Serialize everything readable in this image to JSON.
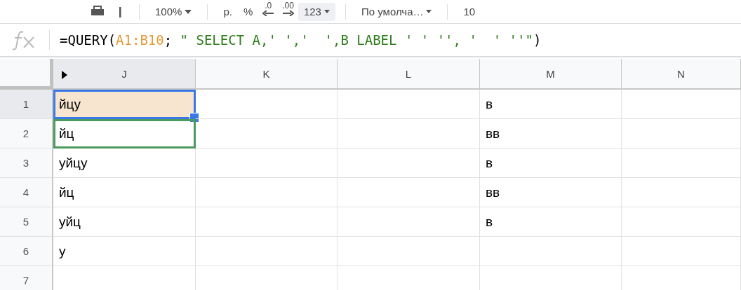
{
  "toolbar": {
    "zoom": "100%",
    "items": [
      {
        "kind": "text",
        "label": "р."
      },
      {
        "kind": "text",
        "label": "%"
      },
      {
        "kind": "decrease",
        "label": ".0"
      },
      {
        "kind": "increase",
        "label": ".00"
      },
      {
        "kind": "menu",
        "label": "123",
        "selected": true
      },
      {
        "kind": "menu",
        "label": "По умолча…",
        "selected": false
      },
      {
        "kind": "text",
        "label": "10"
      }
    ]
  },
  "formula_bar": {
    "segments": [
      {
        "kind": "plain",
        "text": "=QUERY("
      },
      {
        "kind": "range",
        "text": "A1:B10"
      },
      {
        "kind": "plain",
        "text": "; "
      },
      {
        "kind": "string",
        "text": "\" SELECT A,' ','  ',B LABEL ' ' '', '  ' ''\""
      },
      {
        "kind": "plain",
        "text": ")"
      }
    ]
  },
  "columns": [
    {
      "label": "J",
      "selected": true
    },
    {
      "label": "K",
      "selected": false
    },
    {
      "label": "L",
      "selected": false
    },
    {
      "label": "M",
      "selected": false
    },
    {
      "label": "N",
      "selected": false
    }
  ],
  "rows": [
    {
      "number": "1",
      "selected": true,
      "j": "йцу",
      "j_active": true,
      "j_outlined": false,
      "m": "в"
    },
    {
      "number": "2",
      "selected": false,
      "j": "йц",
      "j_active": false,
      "j_outlined": true,
      "m": "вв"
    },
    {
      "number": "3",
      "selected": false,
      "j": "уйцу",
      "j_active": false,
      "j_outlined": false,
      "m": "в"
    },
    {
      "number": "4",
      "selected": false,
      "j": "йц",
      "j_active": false,
      "j_outlined": false,
      "m": "вв"
    },
    {
      "number": "5",
      "selected": false,
      "j": "уйц",
      "j_active": false,
      "j_outlined": false,
      "m": "в"
    },
    {
      "number": "6",
      "selected": false,
      "j": "у",
      "j_active": false,
      "j_outlined": false
    },
    {
      "number": "7",
      "selected": false
    }
  ]
}
